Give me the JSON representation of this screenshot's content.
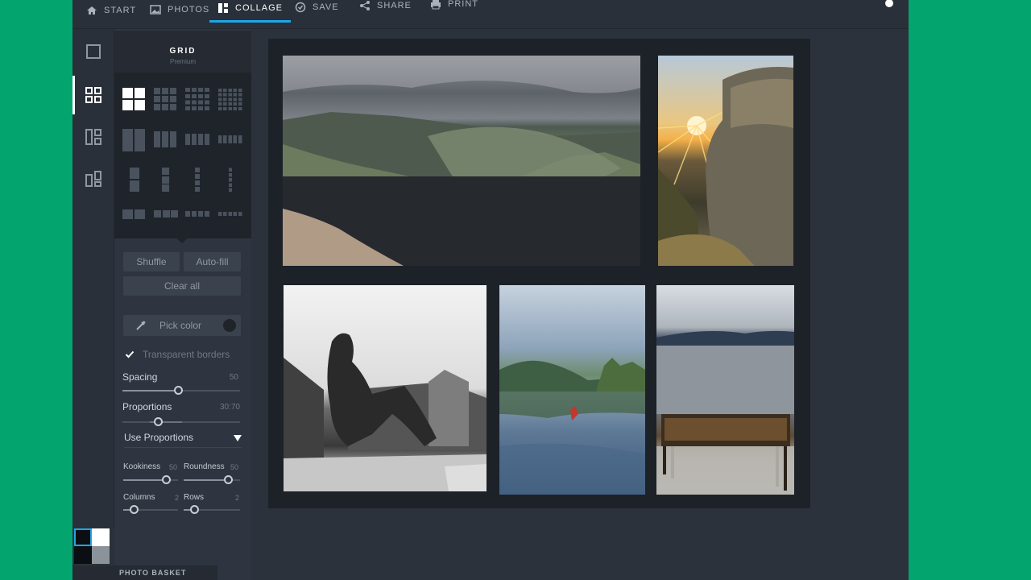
{
  "toolbar": {
    "tabs": [
      {
        "label": "START",
        "icon": "home-icon"
      },
      {
        "label": "PHOTOS",
        "icon": "image-icon"
      },
      {
        "label": "COLLAGE",
        "icon": "collage-icon",
        "active": true
      },
      {
        "label": "SAVE",
        "icon": "check-circle-icon"
      },
      {
        "label": "SHARE",
        "icon": "share-icon"
      },
      {
        "label": "PRINT",
        "icon": "printer-icon"
      }
    ],
    "accent": "#1fa6e6"
  },
  "rail": {
    "items": [
      {
        "icon": "single-frame-icon"
      },
      {
        "icon": "grid-icon",
        "active": true
      },
      {
        "icon": "mosaic-icon"
      },
      {
        "icon": "freestyle-icon"
      }
    ]
  },
  "panel": {
    "title": "GRID",
    "subtitle": "Premium",
    "buttons": {
      "shuffle": "Shuffle",
      "autofill": "Auto-fill",
      "clear_all": "Clear all"
    },
    "pick_color": "Pick color",
    "transparent_borders": "Transparent borders",
    "spacing": {
      "label": "Spacing",
      "value": "50"
    },
    "proportions": {
      "label": "Proportions",
      "value": "30:70"
    },
    "use_proportions": "Use Proportions",
    "kookiness": {
      "label": "Kookiness",
      "value": "50"
    },
    "roundness": {
      "label": "Roundness",
      "value": "50"
    },
    "columns": {
      "label": "Columns",
      "value": "2"
    },
    "rows": {
      "label": "Rows",
      "value": "2"
    }
  },
  "basket": {
    "label": "PHOTO BASKET"
  },
  "colors": {
    "background_green": "#04a46f",
    "app_bg": "#2b313b",
    "panel_bg": "#2e3540"
  }
}
